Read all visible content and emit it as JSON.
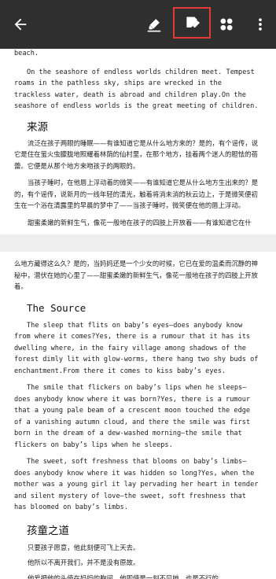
{
  "toolbar": {
    "icons": [
      "back-arrow-icon",
      "highlighter-pen-icon",
      "edit-note-icon",
      "apps-grid-icon",
      "more-vert-icon"
    ],
    "highlight_color": "#e53935",
    "background": "#2f2f2f"
  },
  "page1": {
    "top_fragment": "beach.",
    "en_para1": "On the seashore of endless worlds children meet. Tempest roams in the pathless sky, ships are wrecked in the trackless water, death is abroad and children play.On the seashore of endless worlds is the great meeting of children.",
    "zh_heading": "来源",
    "zh_para1": "流泛在孩子两眼的睡眠——有谁知道它是从什么地方来的？是的，有个谣传，说它是住在萤火虫朦胧地照耀着林荫的仙村里，在那个地方，挂着两个迷人的胆怯的蓓蕾。它便是从那个地方来吻孩子的两眼的。",
    "zh_para2": "当孩子睡时，在他唇上浮动着的微笑——有谁知道它是从什么地方生出来的？是的，有个谣传，说新月的一线年轻的清光，触着将消未消的秋云边上，于是微笑便初生在一个浴在清露里的早晨的梦中了——当孩子睡时，微笑便在他的唇上浮动。",
    "zh_para3": "甜蜜柔嫩的新鲜生气，像花一般地在孩子的四肢上开放着——有谁知道它在什"
  },
  "page2": {
    "zh_para_cont": "么地方藏得这么久？是的，当妈妈还是一个少女的时候，它已在爱的温柔而沉静的神秘中，潜伏在她的心里了——甜蜜柔嫩的新鲜生气，像花一般地在孩子的四肢上开放着。",
    "en_heading": "The Source",
    "en_para1": "The sleep that flits on baby’s eyes—does anybody know from where it comes?Yes, there is a rumour that it has its dwelling where, in the fairy village among shadows of the forest dimly lit with glow-worms, there hang two shy buds of enchantment.From there it comes to kiss baby’s eyes.",
    "en_para2": "The smile that flickers on baby’s lips when he sleeps—does anybody know where it was born?Yes, there is a rumour that a young pale beam of a crescent moon touched the edge of a vanishing autumn cloud, and there the smile was first born in the dream of a dew-washed morning—the smile that flickers on baby’s lips when he sleeps.",
    "en_para3": "The sweet, soft freshness that blooms on baby’s limbs—does anybody know where it was hidden so long?Yes, when the mother was a young girl it lay pervading her heart in tender and silent mystery of love—the sweet, soft freshness that has bloomed on baby’s limbs.",
    "zh_heading2": "孩童之道",
    "zh_line1": "只要孩子愿意，他此刻便可飞上天去。",
    "zh_line2": "他所以不离开我们，并不是没有原故。",
    "zh_line3": "他爱把他的头倚在妈妈的胸间，他即使是一刻不见她，也是不行的。"
  }
}
